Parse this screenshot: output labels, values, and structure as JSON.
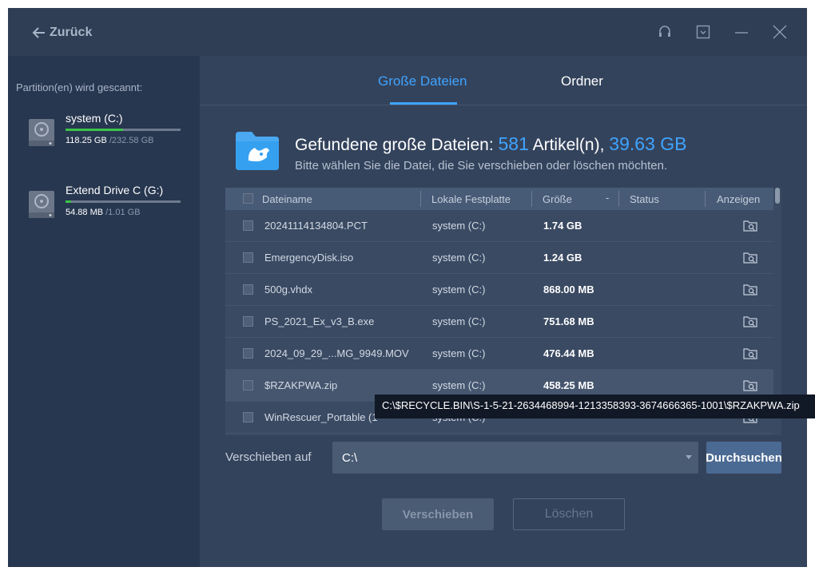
{
  "titlebar": {
    "back_label": "Zurück"
  },
  "sidebar": {
    "title": "Partition(en) wird gescannt:",
    "drives": [
      {
        "name": "system (C:)",
        "used": "118.25 GB",
        "total": "/232.58 GB",
        "fill_fraction": 0.5
      },
      {
        "name": "Extend Drive C (G:)",
        "used": "54.88 MB",
        "total": "/1.01 GB",
        "fill_fraction": 0.05
      }
    ]
  },
  "tabs": {
    "large_files": "Große Dateien",
    "folders": "Ordner"
  },
  "summary": {
    "title_prefix": "Gefundene große Dateien:",
    "count": "581",
    "count_suffix": "Artikel(n),",
    "total_size": "39.63 GB",
    "subtitle": "Bitte wählen Sie die Datei, die Sie verschieben oder löschen möchten."
  },
  "table": {
    "columns": {
      "name": "Dateiname",
      "disk": "Lokale Festplatte",
      "size": "Größe",
      "status": "Status",
      "view": "Anzeigen"
    },
    "rows": [
      {
        "name": "20241114134804.PCT",
        "disk": "system (C:)",
        "size": "1.74 GB"
      },
      {
        "name": "EmergencyDisk.iso",
        "disk": "system (C:)",
        "size": "1.24 GB"
      },
      {
        "name": "500g.vhdx",
        "disk": "system (C:)",
        "size": "868.00 MB"
      },
      {
        "name": "PS_2021_Ex_v3_B.exe",
        "disk": "system (C:)",
        "size": "751.68 MB"
      },
      {
        "name": "2024_09_29_...MG_9949.MOV",
        "disk": "system (C:)",
        "size": "476.44 MB"
      },
      {
        "name": "$RZAKPWA.zip",
        "disk": "system (C:)",
        "size": "458.25 MB"
      },
      {
        "name": "WinRescuer_Portable (1",
        "disk": "system (C:)",
        "size": ""
      }
    ]
  },
  "tooltip": "C:\\$RECYCLE.BIN\\S-1-5-21-2634468994-1213358393-3674666365-1001\\$RZAKPWA.zip",
  "move": {
    "label": "Verschieben auf",
    "path": "C:\\",
    "browse": "Durchsuchen"
  },
  "actions": {
    "move": "Verschieben",
    "delete": "Löschen"
  },
  "colors": {
    "accent": "#3fa4ff",
    "progress": "#3dc34a",
    "background": "#2f3e55"
  }
}
